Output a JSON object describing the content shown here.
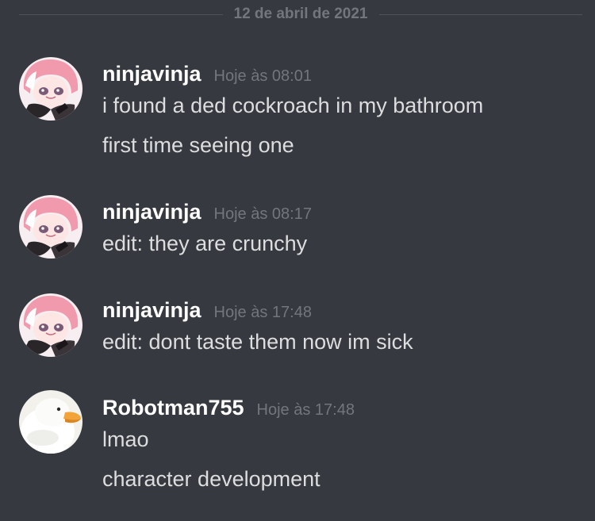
{
  "divider": {
    "date": "12 de abril de 2021"
  },
  "messages": [
    {
      "username": "ninjavinja",
      "timestamp": "Hoje às 08:01",
      "avatar": "anime-girl-avatar",
      "lines": [
        "i found a ded cockroach in my bathroom",
        "first time  seeing one"
      ]
    },
    {
      "username": "ninjavinja",
      "timestamp": "Hoje às 08:17",
      "avatar": "anime-girl-avatar",
      "lines": [
        "edit: they are crunchy"
      ]
    },
    {
      "username": "ninjavinja",
      "timestamp": "Hoje às 17:48",
      "avatar": "anime-girl-avatar",
      "lines": [
        "edit: dont taste them now im sick"
      ]
    },
    {
      "username": "Robotman755",
      "timestamp": "Hoje às 17:48",
      "avatar": "duck-avatar",
      "lines": [
        "lmao",
        "character development"
      ]
    }
  ],
  "colors": {
    "background": "#36393f",
    "username": "#ffffff",
    "message_text": "#dcddde",
    "timestamp": "#72767d",
    "divider": "#4f545c"
  }
}
